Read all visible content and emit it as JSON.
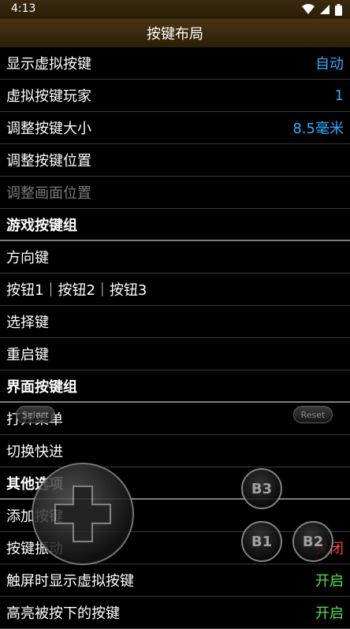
{
  "status": {
    "time": "4:13"
  },
  "title": "按键布局",
  "rows": [
    {
      "label": "显示虚拟按键",
      "value": "自动",
      "value_color": "#33aaff"
    },
    {
      "label": "虚拟按键玩家",
      "value": "1",
      "value_color": "#33aaff"
    },
    {
      "label": "调整按键大小",
      "value": "8.5毫米",
      "value_color": "#33aaff"
    },
    {
      "label": "调整按键位置"
    },
    {
      "label": "调整画面位置",
      "disabled": true
    },
    {
      "label": "游戏按键组",
      "group": true
    },
    {
      "label": "方向键"
    },
    {
      "label": "按钮1｜按钮2｜按钮3"
    },
    {
      "label": "选择键"
    },
    {
      "label": "重启键"
    },
    {
      "label": "界面按键组",
      "group": true
    },
    {
      "label": "打开菜单"
    },
    {
      "label": "切换快进"
    },
    {
      "label": "其他选项",
      "group": true
    },
    {
      "label": "添加按键"
    },
    {
      "label": "按键振动",
      "value": "关闭",
      "value_color": "#ff4040"
    },
    {
      "label": "触屏时显示虚拟按键",
      "value": "开启",
      "value_color": "#58e04b"
    },
    {
      "label": "高亮被按下的按键",
      "value": "开启",
      "value_color": "#58e04b"
    }
  ],
  "overlay": {
    "select_label": "Select",
    "reset_label": "Reset",
    "b3_label": "B3",
    "b1_label": "B1",
    "b2_label": "B2"
  }
}
